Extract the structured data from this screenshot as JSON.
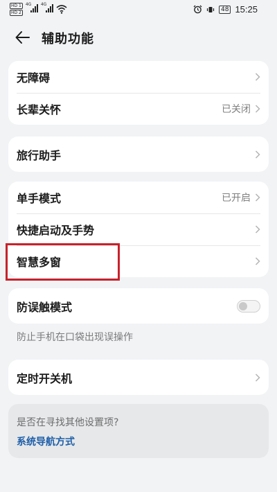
{
  "status_bar": {
    "sim1": "HD 1",
    "sim2": "HD 2",
    "network1": "4G",
    "network2": "4G",
    "battery": "48",
    "time": "15:25"
  },
  "header": {
    "title": "辅助功能",
    "back_icon": "arrow-left-icon"
  },
  "groups": {
    "g1": [
      {
        "label": "无障碍",
        "value": ""
      },
      {
        "label": "长辈关怀",
        "value": "已关闭"
      }
    ],
    "g2": [
      {
        "label": "旅行助手",
        "value": ""
      }
    ],
    "g3": [
      {
        "label": "单手模式",
        "value": "已开启"
      },
      {
        "label": "快捷启动及手势",
        "value": ""
      },
      {
        "label": "智慧多窗",
        "value": ""
      }
    ],
    "g4": [
      {
        "label": "防误触模式",
        "toggle_on": false
      }
    ],
    "g4_caption": "防止手机在口袋出现误操作",
    "g5": [
      {
        "label": "定时开关机",
        "value": ""
      }
    ]
  },
  "suggestion": {
    "question": "是否在寻找其他设置项?",
    "link": "系统导航方式"
  },
  "colors": {
    "background": "#f1f3f5",
    "card": "#ffffff",
    "link": "#1e5ea8",
    "highlight": "#c8212b"
  }
}
